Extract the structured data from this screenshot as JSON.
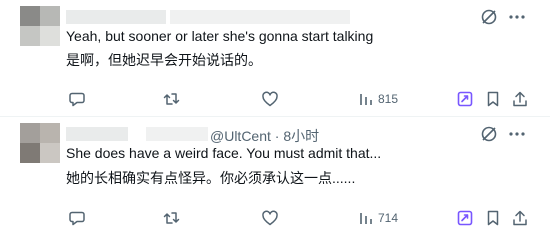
{
  "posts": [
    {
      "id": "post-1",
      "meta": "",
      "text_en": "Yeah, but sooner or later she's gonna start talking",
      "text_zh": "是啊，但她迟早会开始说话的。",
      "views": "815"
    },
    {
      "id": "post-2",
      "meta": "@UltCent · 8小时",
      "text_en": "She does have a weird face. You must admit that...",
      "text_zh": "她的长相确实有点怪异。你必须承认这一点......",
      "views": "714"
    }
  ],
  "icons": {
    "reply": "reply-icon",
    "repost": "repost-icon",
    "like": "like-icon",
    "views": "views-icon",
    "grok": "grok-icon",
    "bookmark": "bookmark-icon",
    "share": "share-icon",
    "no-translate": "slashed-circle-icon",
    "more": "more-icon"
  },
  "colors": {
    "text": "#0f1419",
    "secondary": "#536471",
    "grok_accent": "#7856ff",
    "divider": "#eff3f4"
  }
}
